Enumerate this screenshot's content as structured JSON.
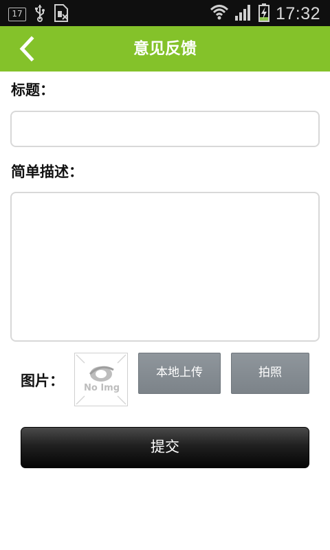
{
  "status_bar": {
    "calendar_day": "17",
    "time": "17:32",
    "icons": [
      "calendar-icon",
      "usb-icon",
      "sim-icon",
      "wifi-icon",
      "signal-icon",
      "battery-charging-icon"
    ]
  },
  "header": {
    "title": "意见反馈",
    "back_icon": "chevron-left-icon",
    "background_color": "#84c22a"
  },
  "form": {
    "title_label": "标题：",
    "title_value": "",
    "description_label": "简单描述：",
    "description_value": "",
    "image_label": "图片：",
    "image_placeholder_text": "No Img",
    "upload_button": "本地上传",
    "camera_button": "拍照",
    "submit_button": "提交"
  }
}
